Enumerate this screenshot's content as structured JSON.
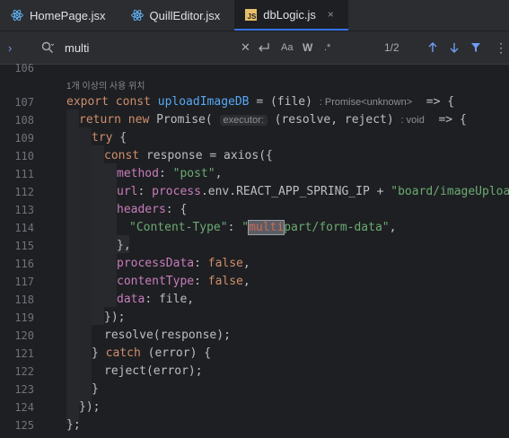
{
  "tabs": [
    {
      "label": "HomePage.jsx",
      "icon": "react-icon",
      "active": false
    },
    {
      "label": "QuillEditor.jsx",
      "icon": "react-icon",
      "active": false
    },
    {
      "label": "dbLogic.js",
      "icon": "js-file-icon",
      "active": true,
      "close": "×"
    }
  ],
  "search": {
    "query": "multi",
    "match_count": "1/2",
    "match_case": "Aa",
    "words": "W",
    "regex": ".*"
  },
  "editor": {
    "hint_line": "1개 이상의 사용 위치",
    "prev_line_number": "106",
    "lines": [
      {
        "n": "107",
        "text": "export const uploadImageDB = (file)"
      },
      {
        "n": "108",
        "text": "return new Promise("
      },
      {
        "n": "109",
        "text": "try {"
      },
      {
        "n": "110",
        "text": "const response = axios({"
      },
      {
        "n": "111",
        "text": "method: \"post\","
      },
      {
        "n": "112",
        "text": "url: process.env.REACT_APP_SPRING_IP + \"board/imageUpload\","
      },
      {
        "n": "113",
        "text": "headers: {"
      },
      {
        "n": "114",
        "text": "\"Content-Type\": \"multipart/form-data\","
      },
      {
        "n": "115",
        "text": "},"
      },
      {
        "n": "116",
        "text": "processData: false,"
      },
      {
        "n": "117",
        "text": "contentType: false,"
      },
      {
        "n": "118",
        "text": "data: file,"
      },
      {
        "n": "119",
        "text": "});"
      },
      {
        "n": "120",
        "text": "resolve(response);"
      },
      {
        "n": "121",
        "text": "} catch (error) {"
      },
      {
        "n": "122",
        "text": "reject(error);"
      },
      {
        "n": "123",
        "text": "}"
      },
      {
        "n": "124",
        "text": "});"
      },
      {
        "n": "125",
        "text": "};"
      }
    ],
    "inlays": {
      "promise_type": ": Promise<unknown>",
      "executor": "executor:",
      "void_type": ": void"
    }
  }
}
